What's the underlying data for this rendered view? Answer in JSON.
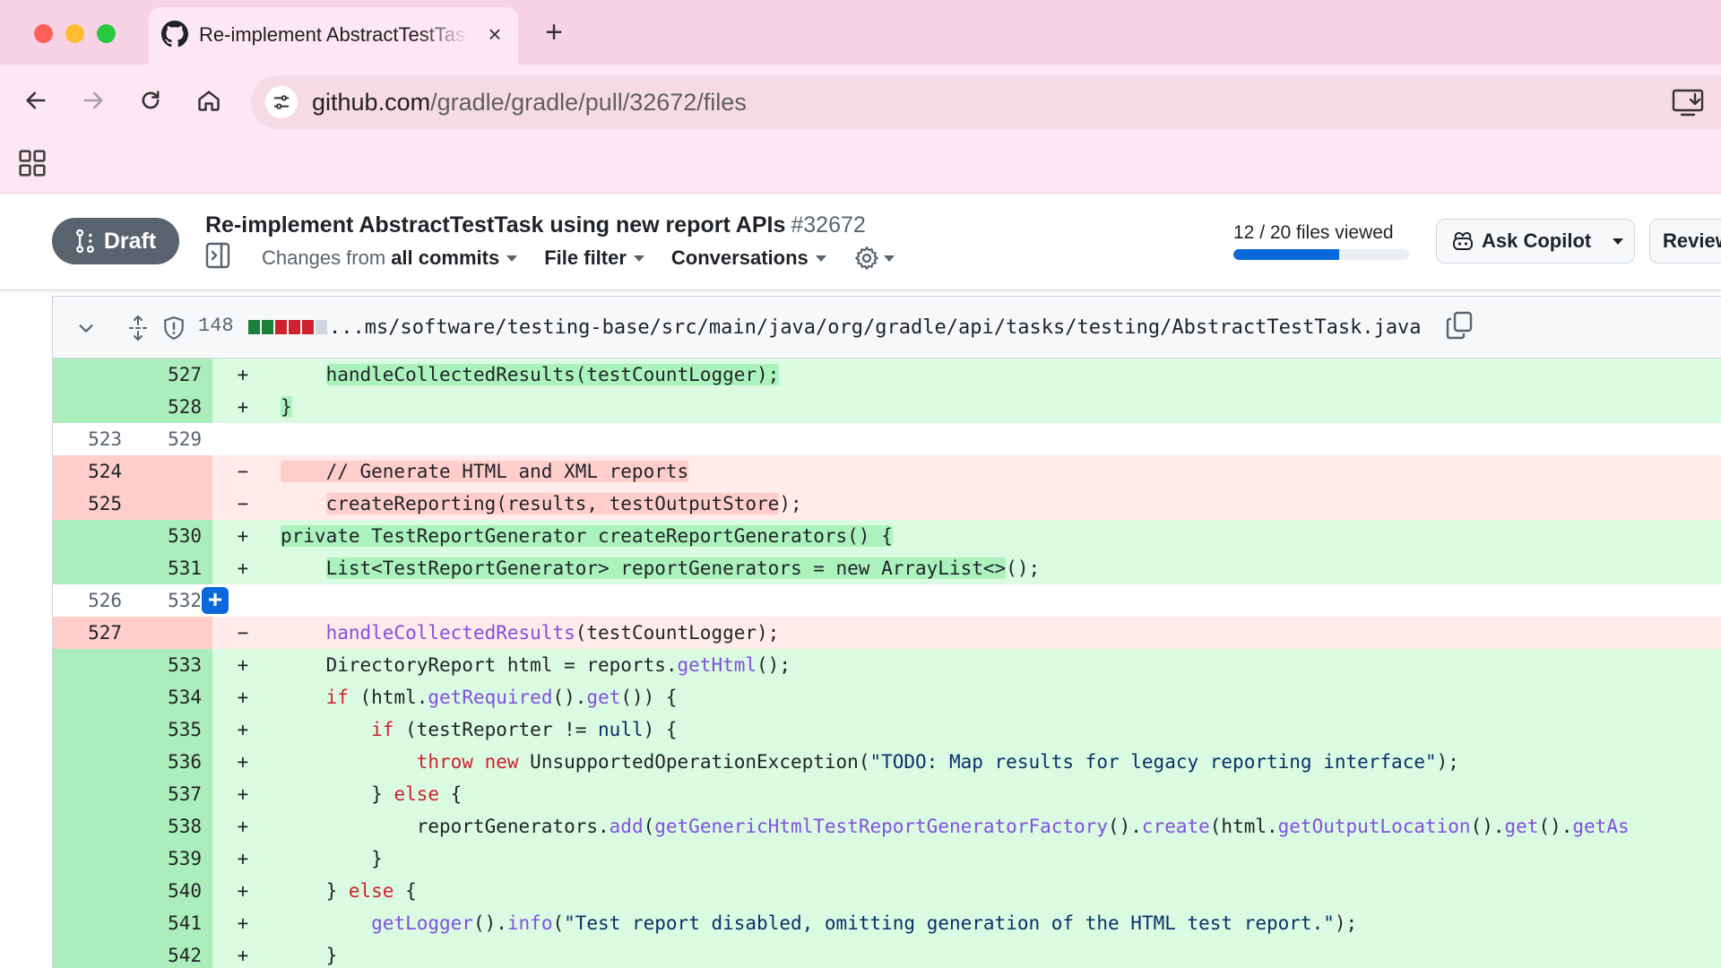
{
  "browser": {
    "tab_title": "Re-implement AbstractTestTask using new report APIs",
    "url_host": "github.com",
    "url_path": "/gradle/gradle/pull/32672/files"
  },
  "pr": {
    "status": "Draft",
    "title": "Re-implement AbstractTestTask using new report APIs",
    "number": "#32672",
    "changes_from_prefix": "Changes from",
    "changes_from_value": "all commits",
    "file_filter": "File filter",
    "conversations": "Conversations",
    "files_viewed": "12 / 20 files viewed",
    "files_viewed_fraction": 0.6,
    "ask_copilot": "Ask Copilot",
    "review": "Review"
  },
  "file": {
    "change_count": "148",
    "path": "...ms/software/testing-base/src/main/java/org/gradle/api/tasks/testing/AbstractTestTask.java",
    "diffstat_colors": [
      "#1a7f37",
      "#1a7f37",
      "#cf222e",
      "#cf222e",
      "#cf222e",
      "#d0d7de"
    ]
  },
  "diff": {
    "rows": [
      {
        "type": "add",
        "old": "",
        "new": "527",
        "sign": "+",
        "indent": "    ",
        "hl": true,
        "tokens": [
          {
            "t": "handleCollectedResults(testCountLogger);",
            "c": ""
          }
        ]
      },
      {
        "type": "add",
        "old": "",
        "new": "528",
        "sign": "+",
        "indent": "",
        "hl": true,
        "tokens": [
          {
            "t": "}",
            "c": ""
          }
        ]
      },
      {
        "type": "ctx",
        "old": "523",
        "new": "529",
        "sign": "",
        "indent": "",
        "hl": false,
        "tokens": []
      },
      {
        "type": "del",
        "old": "524",
        "new": "",
        "sign": "−",
        "indent": "",
        "hl": true,
        "tokens": [
          {
            "t": "    // Generate HTML and XML reports",
            "c": ""
          }
        ]
      },
      {
        "type": "del",
        "old": "525",
        "new": "",
        "sign": "−",
        "indent": "    ",
        "hl": true,
        "tokens": [
          {
            "t": "createReporting(results, testOutputStore",
            "c": ""
          },
          {
            "t": ");",
            "c": "plain"
          }
        ]
      },
      {
        "type": "add",
        "old": "",
        "new": "530",
        "sign": "+",
        "indent": "",
        "hl": true,
        "tokens": [
          {
            "t": "private TestReportGenerator createReportGenerators() {",
            "c": ""
          }
        ]
      },
      {
        "type": "add",
        "old": "",
        "new": "531",
        "sign": "+",
        "indent": "    ",
        "hl": true,
        "tokens": [
          {
            "t": "List<TestReportGenerator> reportGenerators = new ArrayList<>",
            "c": ""
          },
          {
            "t": "();",
            "c": "plain"
          }
        ]
      },
      {
        "type": "ctx",
        "old": "526",
        "new": "532",
        "sign": "",
        "indent": "",
        "hl": false,
        "plus": true,
        "tokens": []
      },
      {
        "type": "del",
        "old": "527",
        "new": "",
        "sign": "−",
        "indent": "    ",
        "hl": false,
        "tokens": [
          {
            "t": "handleCollectedResults",
            "c": "fn"
          },
          {
            "t": "(testCountLogger);",
            "c": ""
          }
        ]
      },
      {
        "type": "add",
        "old": "",
        "new": "533",
        "sign": "+",
        "indent": "    ",
        "hl": false,
        "tokens": [
          {
            "t": "DirectoryReport html = reports.",
            "c": ""
          },
          {
            "t": "getHtml",
            "c": "fn"
          },
          {
            "t": "();",
            "c": ""
          }
        ]
      },
      {
        "type": "add",
        "old": "",
        "new": "534",
        "sign": "+",
        "indent": "    ",
        "hl": false,
        "tokens": [
          {
            "t": "if",
            "c": "kw"
          },
          {
            "t": " (html.",
            "c": ""
          },
          {
            "t": "getRequired",
            "c": "fn"
          },
          {
            "t": "().",
            "c": ""
          },
          {
            "t": "get",
            "c": "fn"
          },
          {
            "t": "()) {",
            "c": ""
          }
        ]
      },
      {
        "type": "add",
        "old": "",
        "new": "535",
        "sign": "+",
        "indent": "        ",
        "hl": false,
        "tokens": [
          {
            "t": "if",
            "c": "kw"
          },
          {
            "t": " (testReporter != ",
            "c": ""
          },
          {
            "t": "null",
            "c": "str"
          },
          {
            "t": ") {",
            "c": ""
          }
        ]
      },
      {
        "type": "add",
        "old": "",
        "new": "536",
        "sign": "+",
        "indent": "            ",
        "hl": false,
        "tokens": [
          {
            "t": "throw",
            "c": "kw"
          },
          {
            "t": " ",
            "c": ""
          },
          {
            "t": "new",
            "c": "kw"
          },
          {
            "t": " UnsupportedOperationException(",
            "c": ""
          },
          {
            "t": "\"TODO: Map results for legacy reporting interface\"",
            "c": "str"
          },
          {
            "t": ");",
            "c": ""
          }
        ]
      },
      {
        "type": "add",
        "old": "",
        "new": "537",
        "sign": "+",
        "indent": "        ",
        "hl": false,
        "tokens": [
          {
            "t": "} ",
            "c": ""
          },
          {
            "t": "else",
            "c": "kw"
          },
          {
            "t": " {",
            "c": ""
          }
        ]
      },
      {
        "type": "add",
        "old": "",
        "new": "538",
        "sign": "+",
        "indent": "            ",
        "hl": false,
        "tokens": [
          {
            "t": "reportGenerators.",
            "c": ""
          },
          {
            "t": "add",
            "c": "fn"
          },
          {
            "t": "(",
            "c": ""
          },
          {
            "t": "getGenericHtmlTestReportGeneratorFactory",
            "c": "fn"
          },
          {
            "t": "().",
            "c": ""
          },
          {
            "t": "create",
            "c": "fn"
          },
          {
            "t": "(html.",
            "c": ""
          },
          {
            "t": "getOutputLocation",
            "c": "fn"
          },
          {
            "t": "().",
            "c": ""
          },
          {
            "t": "get",
            "c": "fn"
          },
          {
            "t": "().",
            "c": ""
          },
          {
            "t": "getAs",
            "c": "fn"
          }
        ]
      },
      {
        "type": "add",
        "old": "",
        "new": "539",
        "sign": "+",
        "indent": "        ",
        "hl": false,
        "tokens": [
          {
            "t": "}",
            "c": ""
          }
        ]
      },
      {
        "type": "add",
        "old": "",
        "new": "540",
        "sign": "+",
        "indent": "    ",
        "hl": false,
        "tokens": [
          {
            "t": "} ",
            "c": ""
          },
          {
            "t": "else",
            "c": "kw"
          },
          {
            "t": " {",
            "c": ""
          }
        ]
      },
      {
        "type": "add",
        "old": "",
        "new": "541",
        "sign": "+",
        "indent": "        ",
        "hl": false,
        "tokens": [
          {
            "t": "getLogger",
            "c": "fn"
          },
          {
            "t": "().",
            "c": ""
          },
          {
            "t": "info",
            "c": "fn"
          },
          {
            "t": "(",
            "c": ""
          },
          {
            "t": "\"Test report disabled, omitting generation of the HTML test report.\"",
            "c": "str"
          },
          {
            "t": ");",
            "c": ""
          }
        ]
      },
      {
        "type": "add",
        "old": "",
        "new": "542",
        "sign": "+",
        "indent": "    ",
        "hl": false,
        "tokens": [
          {
            "t": "}",
            "c": ""
          }
        ]
      }
    ]
  }
}
